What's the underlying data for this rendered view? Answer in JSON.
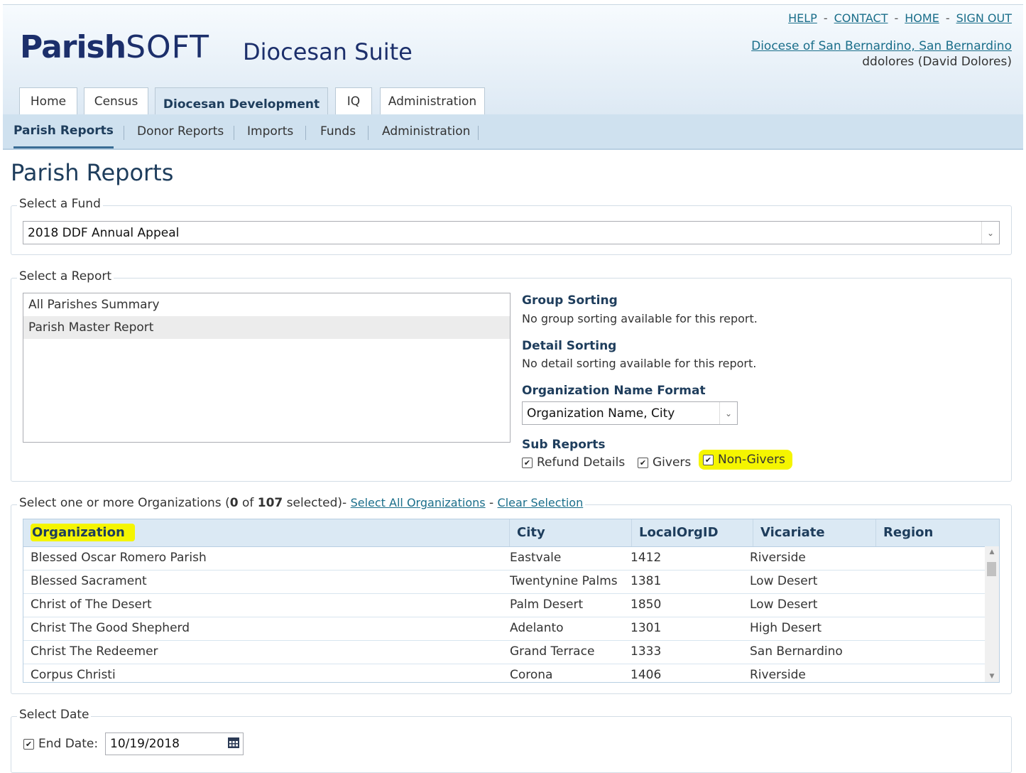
{
  "header": {
    "logo_bold": "Parish",
    "logo_soft": "SOFT",
    "suite_title": "Diocesan Suite",
    "links": [
      "HELP",
      "CONTACT",
      "HOME",
      "SIGN OUT"
    ],
    "link_sep": "-",
    "diocese_link": "Diocese of San Bernardino, San Bernardino",
    "user": "ddolores (David Dolores)"
  },
  "tabs": [
    "Home",
    "Census",
    "Diocesan Development",
    "IQ",
    "Administration"
  ],
  "active_tab": "Diocesan Development",
  "subnav": [
    "Parish Reports",
    "Donor Reports",
    "Imports",
    "Funds",
    "Administration"
  ],
  "active_subnav": "Parish Reports",
  "page_title": "Parish Reports",
  "fund": {
    "legend": "Select a Fund",
    "selected": "2018 DDF Annual Appeal"
  },
  "report": {
    "legend": "Select a Report",
    "items": [
      "All Parishes Summary",
      "Parish Master Report"
    ],
    "selected": "Parish Master Report",
    "group_sorting_label": "Group Sorting",
    "group_sorting_text": "No group sorting available for this report.",
    "detail_sorting_label": "Detail Sorting",
    "detail_sorting_text": "No detail sorting available for this report.",
    "org_name_format_label": "Organization Name Format",
    "org_name_format_value": "Organization Name, City",
    "sub_reports_label": "Sub Reports",
    "sub_reports": [
      {
        "label": "Refund Details",
        "checked": true
      },
      {
        "label": "Givers",
        "checked": true
      },
      {
        "label": "Non-Givers",
        "checked": true
      }
    ]
  },
  "orgs": {
    "legend_prefix": "Select one or more Organizations (",
    "selected_count": "0",
    "of": " of ",
    "total": "107",
    "legend_suffix": " selected)- ",
    "select_all": "Select All Organizations",
    "dash": " - ",
    "clear": "Clear Selection",
    "columns": [
      "Organization",
      "City",
      "LocalOrgID",
      "Vicariate",
      "Region"
    ],
    "rows": [
      [
        "Blessed Oscar Romero Parish",
        "Eastvale",
        "1412",
        "Riverside",
        ""
      ],
      [
        "Blessed Sacrament",
        "Twentynine Palms",
        "1381",
        "Low Desert",
        ""
      ],
      [
        "Christ of The Desert",
        "Palm Desert",
        "1850",
        "Low Desert",
        ""
      ],
      [
        "Christ The Good Shepherd",
        "Adelanto",
        "1301",
        "High Desert",
        ""
      ],
      [
        "Christ The Redeemer",
        "Grand Terrace",
        "1333",
        "San Bernardino",
        ""
      ],
      [
        "Corpus Christi",
        "Corona",
        "1406",
        "Riverside",
        ""
      ]
    ]
  },
  "date": {
    "legend": "Select Date",
    "end_date_label": "End Date:",
    "end_date_checked": true,
    "end_date_value": "10/19/2018"
  },
  "colors": {
    "highlight": "#f5f500",
    "header_blue": "#1c2f6b",
    "subnav_bg": "#cfe1ef",
    "table_header_bg": "#dbe9f4"
  }
}
